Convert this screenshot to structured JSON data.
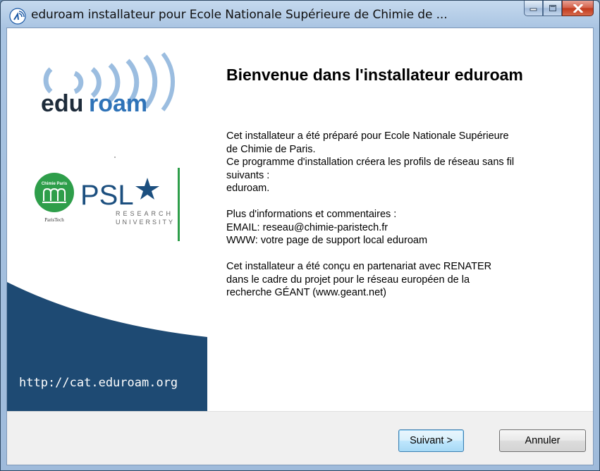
{
  "window": {
    "title": "eduroam installateur pour Ecole Nationale Supérieure de Chimie de ...",
    "icon": "eduroam-wifi-icon"
  },
  "caption_buttons": [
    "minimize-icon",
    "maximize-icon",
    "close-icon"
  ],
  "left_panel": {
    "eduroam_logo": {
      "edu": "edu",
      "roam": "roam"
    },
    "chimie_badge": {
      "top": "Chimie Paris",
      "bottom": "ParisTech"
    },
    "psl_logo": {
      "name": "PSL",
      "line1": "RESEARCH",
      "line2": "UNIVERSITY"
    },
    "url": "http://cat.eduroam.org",
    "colors": {
      "navy": "#1e4a73",
      "eduroam_blue": "#8ab0d4",
      "green": "#2e9e4a"
    }
  },
  "content": {
    "heading": "Bienvenue dans l'installateur eduroam",
    "paragraph1": [
      "Cet installateur a été préparé pour Ecole Nationale Supérieure",
      "de Chimie de Paris.",
      "Ce programme d'installation créera les profils de réseau sans fil",
      "suivants :",
      "eduroam."
    ],
    "paragraph2": [
      "Plus d'informations et commentaires :",
      "EMAIL: reseau@chimie-paristech.fr",
      "WWW: votre page de support local eduroam"
    ],
    "paragraph3": [
      "Cet installateur a été conçu en partenariat avec RENATER",
      "dans le cadre du projet pour le réseau européen de la",
      "recherche GÉANT (www.geant.net)"
    ]
  },
  "footer": {
    "next_label": "Suivant >",
    "cancel_label": "Annuler"
  }
}
